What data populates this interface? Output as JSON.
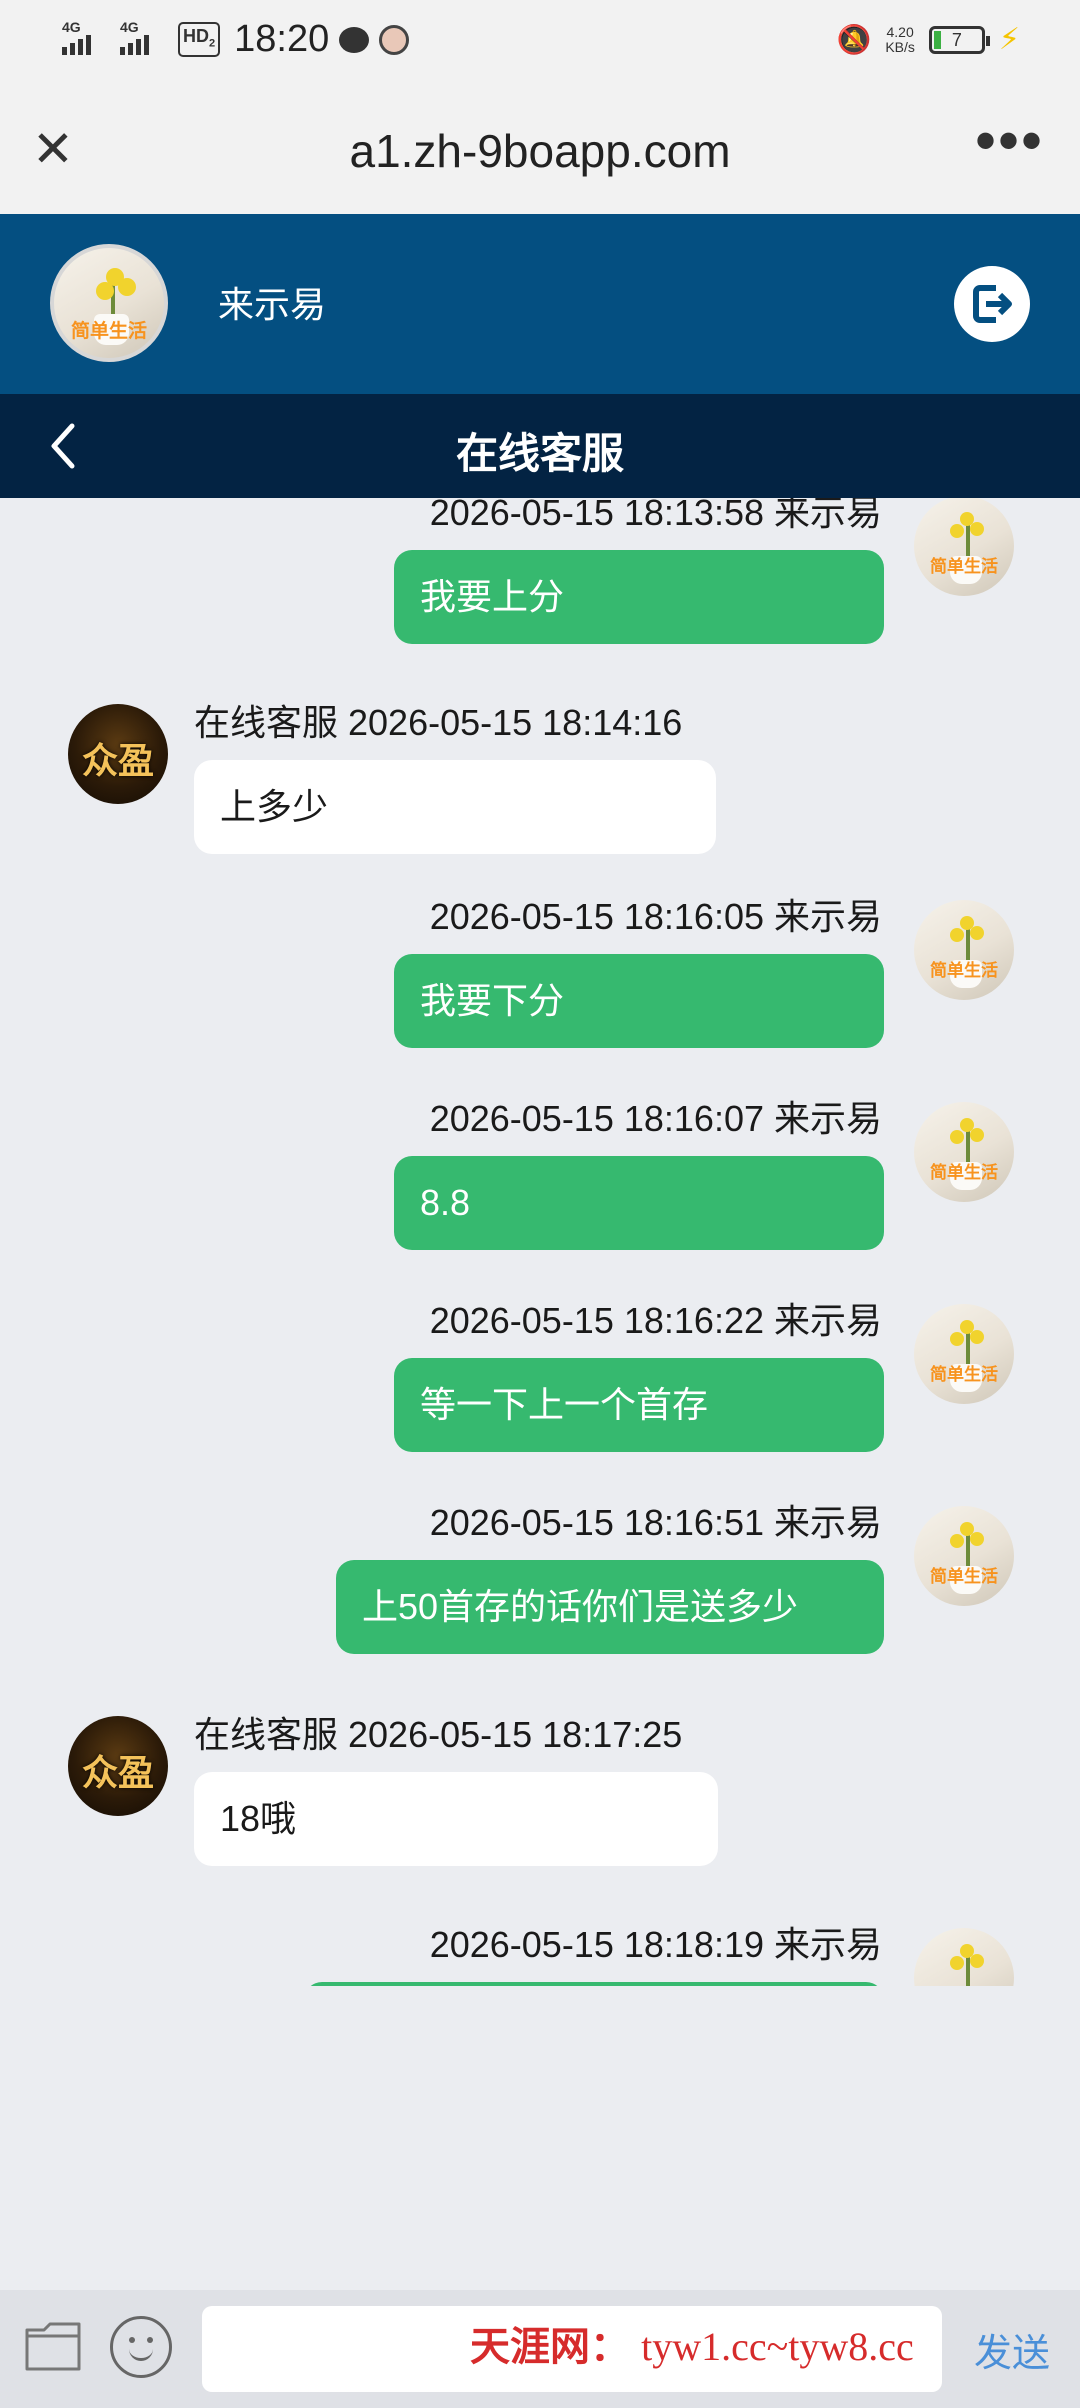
{
  "status_bar": {
    "signal1": "4G",
    "signal2": "4G",
    "hd": "HD",
    "hd_sub": "2",
    "time": "18:20",
    "net_speed_value": "4.20",
    "net_speed_unit": "KB/s",
    "battery_level": "7"
  },
  "browser": {
    "url": "a1.zh-9boapp.com"
  },
  "user": {
    "name": "来示易",
    "avatar_text": "简单生活"
  },
  "titlebar": {
    "title": "在线客服"
  },
  "agent": {
    "avatar_text": "众盈"
  },
  "messages": [
    {
      "side": "right",
      "meta": "2026-05-15 18:13:58 来示易",
      "text": "我要上分"
    },
    {
      "side": "left",
      "meta": "在线客服 2026-05-15 18:14:16",
      "text": "上多少"
    },
    {
      "side": "right",
      "meta": "2026-05-15 18:16:05 来示易",
      "text": "我要下分"
    },
    {
      "side": "right",
      "meta": "2026-05-15 18:16:07 来示易",
      "text": "8.8"
    },
    {
      "side": "right",
      "meta": "2026-05-15 18:16:22 来示易",
      "text": "等一下上一个首存"
    },
    {
      "side": "right",
      "meta": "2026-05-15 18:16:51 来示易",
      "text": "上50首存的话你们是送多少"
    },
    {
      "side": "left",
      "meta": "在线客服 2026-05-15 18:17:25",
      "text": "18哦"
    },
    {
      "side": "right",
      "meta": "2026-05-15 18:18:19 来示易",
      "text": ""
    }
  ],
  "composer": {
    "input_value": "",
    "send_label": "发送"
  },
  "watermark": {
    "site_name": "天涯网：",
    "urls": "tyw1.cc~tyw8.cc"
  }
}
